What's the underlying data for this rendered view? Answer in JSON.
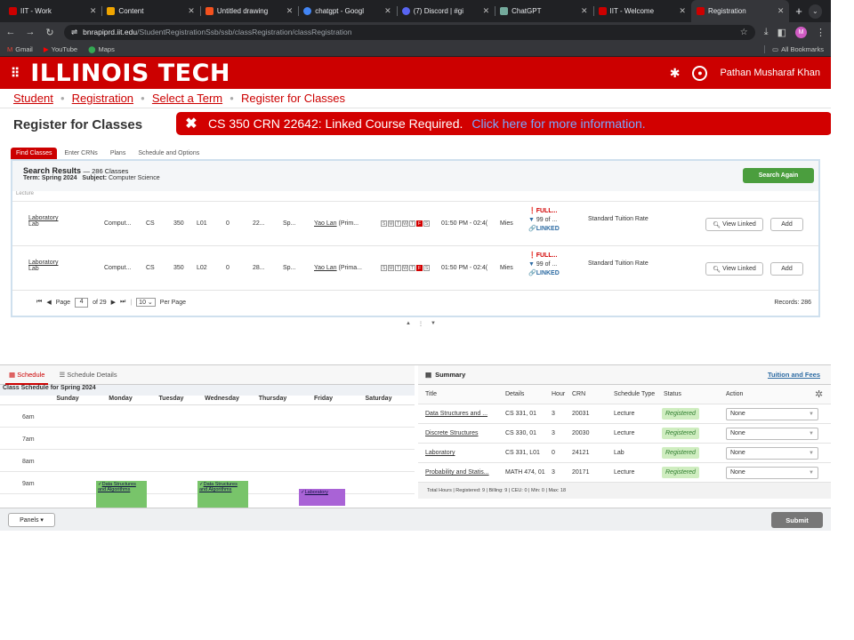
{
  "browser": {
    "tabs": [
      {
        "label": "IIT - Work",
        "color": "#cc0000",
        "icon": "iit-logo-icon"
      },
      {
        "label": "Content",
        "color": "#f0a500",
        "icon": "content-icon"
      },
      {
        "label": "Untitled drawing",
        "color": "#f4511e",
        "icon": "drawing-icon"
      },
      {
        "label": "chatgpt - Googl",
        "color": "#4285f4",
        "icon": "google-icon"
      },
      {
        "label": "(7) Discord | #gi",
        "color": "#5865f2",
        "icon": "discord-icon"
      },
      {
        "label": "ChatGPT",
        "color": "#74aa9c",
        "icon": "chatgpt-icon"
      },
      {
        "label": "IIT - Welcome",
        "color": "#cc0000",
        "icon": "iit-logo-icon"
      },
      {
        "label": "Registration",
        "color": "#cc0000",
        "icon": "iit-logo-icon",
        "active": true
      }
    ],
    "url_host": "bnrapiprd.iit.edu",
    "url_path": "/StudentRegistrationSsb/ssb/classRegistration/classRegistration",
    "profile_initial": "M",
    "bookmarks": [
      "Gmail",
      "YouTube",
      "Maps"
    ],
    "all_bookmarks": "All Bookmarks"
  },
  "header": {
    "logo": "ILLINOIS TECH",
    "user_name": "Pathan Musharaf Khan"
  },
  "breadcrumb": {
    "student": "Student",
    "registration": "Registration",
    "select_term": "Select a Term",
    "current": "Register for Classes"
  },
  "page_title": "Register for Classes",
  "error": {
    "message": "CS 350 CRN 22642: Linked Course Required.",
    "link": "Click here for more information."
  },
  "subtabs": [
    "Find Classes",
    "Enter CRNs",
    "Plans",
    "Schedule and Options"
  ],
  "results": {
    "title": "Search Results",
    "count": "— 286 Classes",
    "term_label": "Term:",
    "term": "Spring 2024",
    "subject_label": "Subject:",
    "subject": "Computer Science",
    "search_again": "Search Again",
    "fragment": "Lecture",
    "rows": [
      {
        "title": "Laboratory",
        "type": "Lab",
        "dept": "Comput...",
        "subject": "CS",
        "course": "350",
        "section": "L01",
        "hours": "0",
        "crn": "22...",
        "term": "Sp...",
        "instructor": "Yao Lan",
        "instructor_suffix": "(Prim...",
        "time": "01:50 PM - 02:4(",
        "campus": "Mies",
        "full": "FULL...",
        "seats": "99 of ...",
        "linked": "LINKED",
        "attribute": "Standard Tuition Rate",
        "view_linked": "View Linked",
        "add": "Add"
      },
      {
        "title": "Laboratory",
        "type": "Lab",
        "dept": "Comput...",
        "subject": "CS",
        "course": "350",
        "section": "L02",
        "hours": "0",
        "crn": "28...",
        "term": "Sp...",
        "instructor": "Yao Lan",
        "instructor_suffix": "(Prima...",
        "time": "01:50 PM - 02:4(",
        "campus": "Mies",
        "full": "FULL...",
        "seats": "99 of ...",
        "linked": "LINKED",
        "attribute": "Standard Tuition Rate",
        "view_linked": "View Linked",
        "add": "Add"
      }
    ],
    "days": [
      "S",
      "M",
      "T",
      "W",
      "T",
      "F",
      "S"
    ],
    "pager": {
      "page_label": "Page",
      "page": "4",
      "of": "of 29",
      "per_page": "10",
      "per_page_label": "Per Page",
      "records": "Records: 286"
    }
  },
  "schedule": {
    "tab_schedule": "Schedule",
    "tab_details": "Schedule Details",
    "title": "Class Schedule for Spring 2024",
    "days": [
      "Sunday",
      "Monday",
      "Tuesday",
      "Wednesday",
      "Thursday",
      "Friday",
      "Saturday"
    ],
    "times": [
      "6am",
      "7am",
      "8am",
      "9am"
    ],
    "events": [
      {
        "label": "Data Structures and Algorithms",
        "day": "Monday"
      },
      {
        "label": "Data Structures and Algorithms",
        "day": "Wednesday"
      },
      {
        "label": "Laboratory",
        "day": "Friday"
      }
    ]
  },
  "summary": {
    "title": "Summary",
    "tuition": "Tuition and Fees",
    "columns": [
      "Title",
      "Details",
      "Hour",
      "CRN",
      "Schedule Type",
      "Status",
      "Action"
    ],
    "rows": [
      {
        "title": "Data Structures and ...",
        "details": "CS 331, 01",
        "hours": "3",
        "crn": "20031",
        "type": "Lecture",
        "status": "Registered",
        "action": "None"
      },
      {
        "title": "Discrete Structures",
        "details": "CS 330, 01",
        "hours": "3",
        "crn": "20030",
        "type": "Lecture",
        "status": "Registered",
        "action": "None"
      },
      {
        "title": "Laboratory",
        "details": "CS 331, L01",
        "hours": "0",
        "crn": "24121",
        "type": "Lab",
        "status": "Registered",
        "action": "None"
      },
      {
        "title": "Probability and Statis...",
        "details": "MATH 474, 01",
        "hours": "3",
        "crn": "20171",
        "type": "Lecture",
        "status": "Registered",
        "action": "None"
      }
    ],
    "totals": "Total Hours | Registered: 9 | Billing: 9 | CEU: 0 | Min: 0 | Max: 18"
  },
  "footer": {
    "panels": "Panels",
    "submit": "Submit"
  }
}
